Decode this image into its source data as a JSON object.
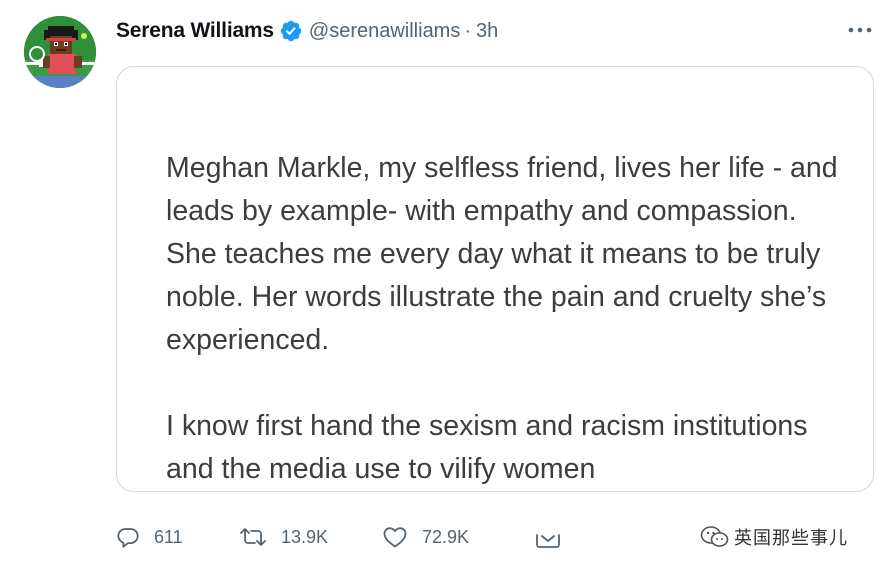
{
  "tweet": {
    "display_name": "Serena Williams",
    "handle": "@serenawilliams",
    "separator": "·",
    "time": "3h",
    "verified_icon": "verified-badge-icon",
    "more_icon": "more-horizontal-icon",
    "card": {
      "paragraphs": [
        "Meghan Markle, my selfless friend, lives her life - and leads by example- with empathy and compassion. She teaches me every day what it means to be truly noble. Her words illustrate the pain and cruelty she’s experienced.",
        "I know first hand the sexism and racism institutions and the media use to vilify women"
      ]
    },
    "actions": {
      "reply_count": "611",
      "retweet_count": "13.9K",
      "like_count": "72.9K"
    }
  },
  "watermark": {
    "text": "英国那些事儿"
  },
  "colors": {
    "accent": "#1d9bf0",
    "secondary_text": "#536471",
    "card_border": "#cfd9de",
    "card_text": "#3d3d3d"
  }
}
